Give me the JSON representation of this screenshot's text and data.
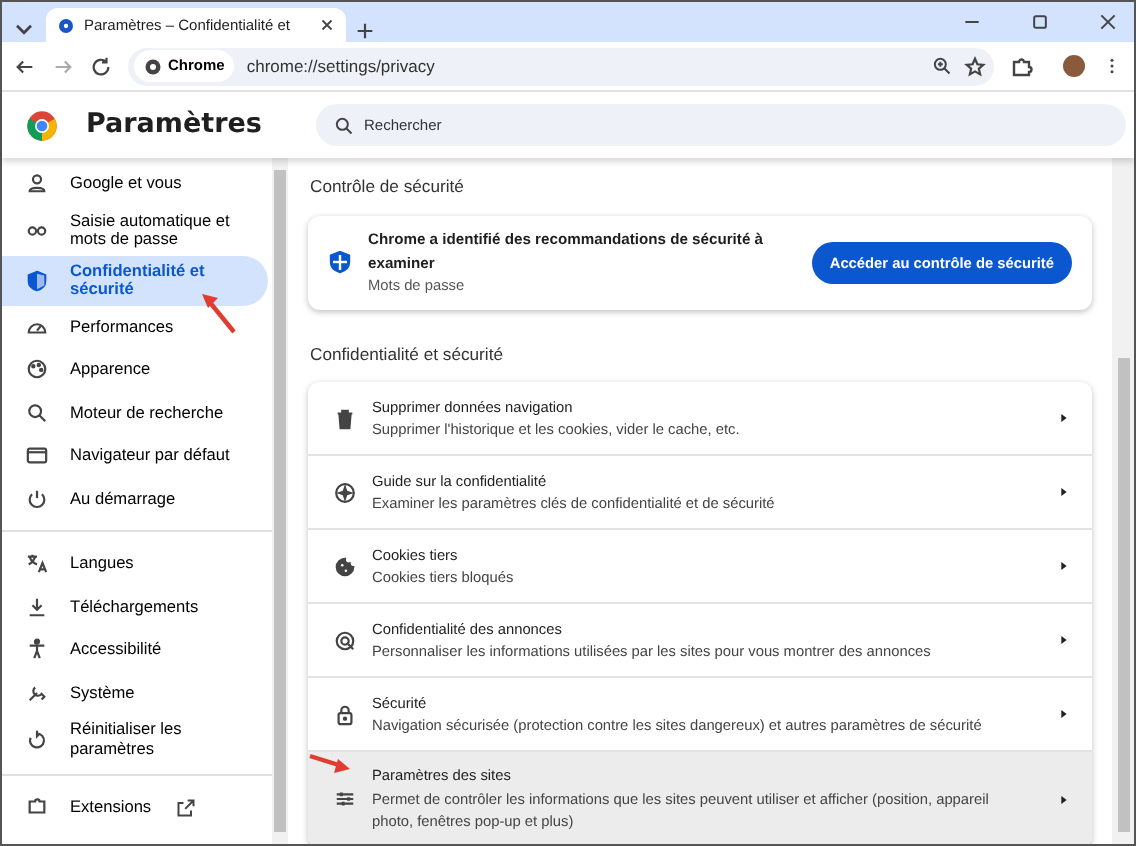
{
  "browser": {
    "tab_title": "Paramètres – Confidentialité et",
    "address_chip": "Chrome",
    "url": "chrome://settings/privacy"
  },
  "header": {
    "title": "Paramètres",
    "search_placeholder": "Rechercher"
  },
  "sidebar": {
    "sections": [
      {
        "items": [
          {
            "label": "Google et vous",
            "selected": false,
            "annotated": false,
            "external": false
          },
          {
            "label": "Saisie automatique et mots de passe",
            "selected": false,
            "annotated": false,
            "external": false
          },
          {
            "label": "Confidentialité et sécurité",
            "selected": true,
            "annotated": true,
            "external": false
          },
          {
            "label": "Performances",
            "selected": false,
            "annotated": false,
            "external": false
          },
          {
            "label": "Apparence",
            "selected": false,
            "annotated": false,
            "external": false
          },
          {
            "label": "Moteur de recherche",
            "selected": false,
            "annotated": false,
            "external": false
          },
          {
            "label": "Navigateur par défaut",
            "selected": false,
            "annotated": false,
            "external": false
          },
          {
            "label": "Au démarrage",
            "selected": false,
            "annotated": false,
            "external": false
          }
        ]
      },
      {
        "items": [
          {
            "label": "Langues",
            "selected": false,
            "annotated": false,
            "external": false
          },
          {
            "label": "Téléchargements",
            "selected": false,
            "annotated": false,
            "external": false
          },
          {
            "label": "Accessibilité",
            "selected": false,
            "annotated": false,
            "external": false
          },
          {
            "label": "Système",
            "selected": false,
            "annotated": false,
            "external": false
          },
          {
            "label": "Réinitialiser les paramètres",
            "selected": false,
            "annotated": false,
            "external": false
          }
        ]
      },
      {
        "items": [
          {
            "label": "Extensions",
            "selected": false,
            "annotated": false,
            "external": true
          }
        ]
      }
    ]
  },
  "safety_check": {
    "heading": "Contrôle de sécurité",
    "message": "Chrome a identifié des recommandations de sécurité à examiner",
    "detail": "Mots de passe",
    "button": "Accéder au contrôle de sécurité"
  },
  "privacy": {
    "heading": "Confidentialité et sécurité",
    "rows": [
      {
        "title": "Supprimer données navigation",
        "description": "Supprimer l'historique et les cookies, vider le cache, etc.",
        "highlighted": false,
        "annotated": false
      },
      {
        "title": "Guide sur la confidentialité",
        "description": "Examiner les paramètres clés de confidentialité et de sécurité",
        "highlighted": false,
        "annotated": false
      },
      {
        "title": "Cookies tiers",
        "description": "Cookies tiers bloqués",
        "highlighted": false,
        "annotated": false
      },
      {
        "title": "Confidentialité des annonces",
        "description": "Personnaliser les informations utilisées par les sites pour vous montrer des annonces",
        "highlighted": false,
        "annotated": false
      },
      {
        "title": "Sécurité",
        "description": "Navigation sécurisée (protection contre les sites dangereux) et autres paramètres de sécurité",
        "highlighted": false,
        "annotated": false
      },
      {
        "title": "Paramètres des sites",
        "description": "Permet de contrôler les informations que les sites peuvent utiliser et afficher (position, appareil photo, fenêtres pop-up et plus)",
        "highlighted": true,
        "annotated": true
      }
    ]
  }
}
